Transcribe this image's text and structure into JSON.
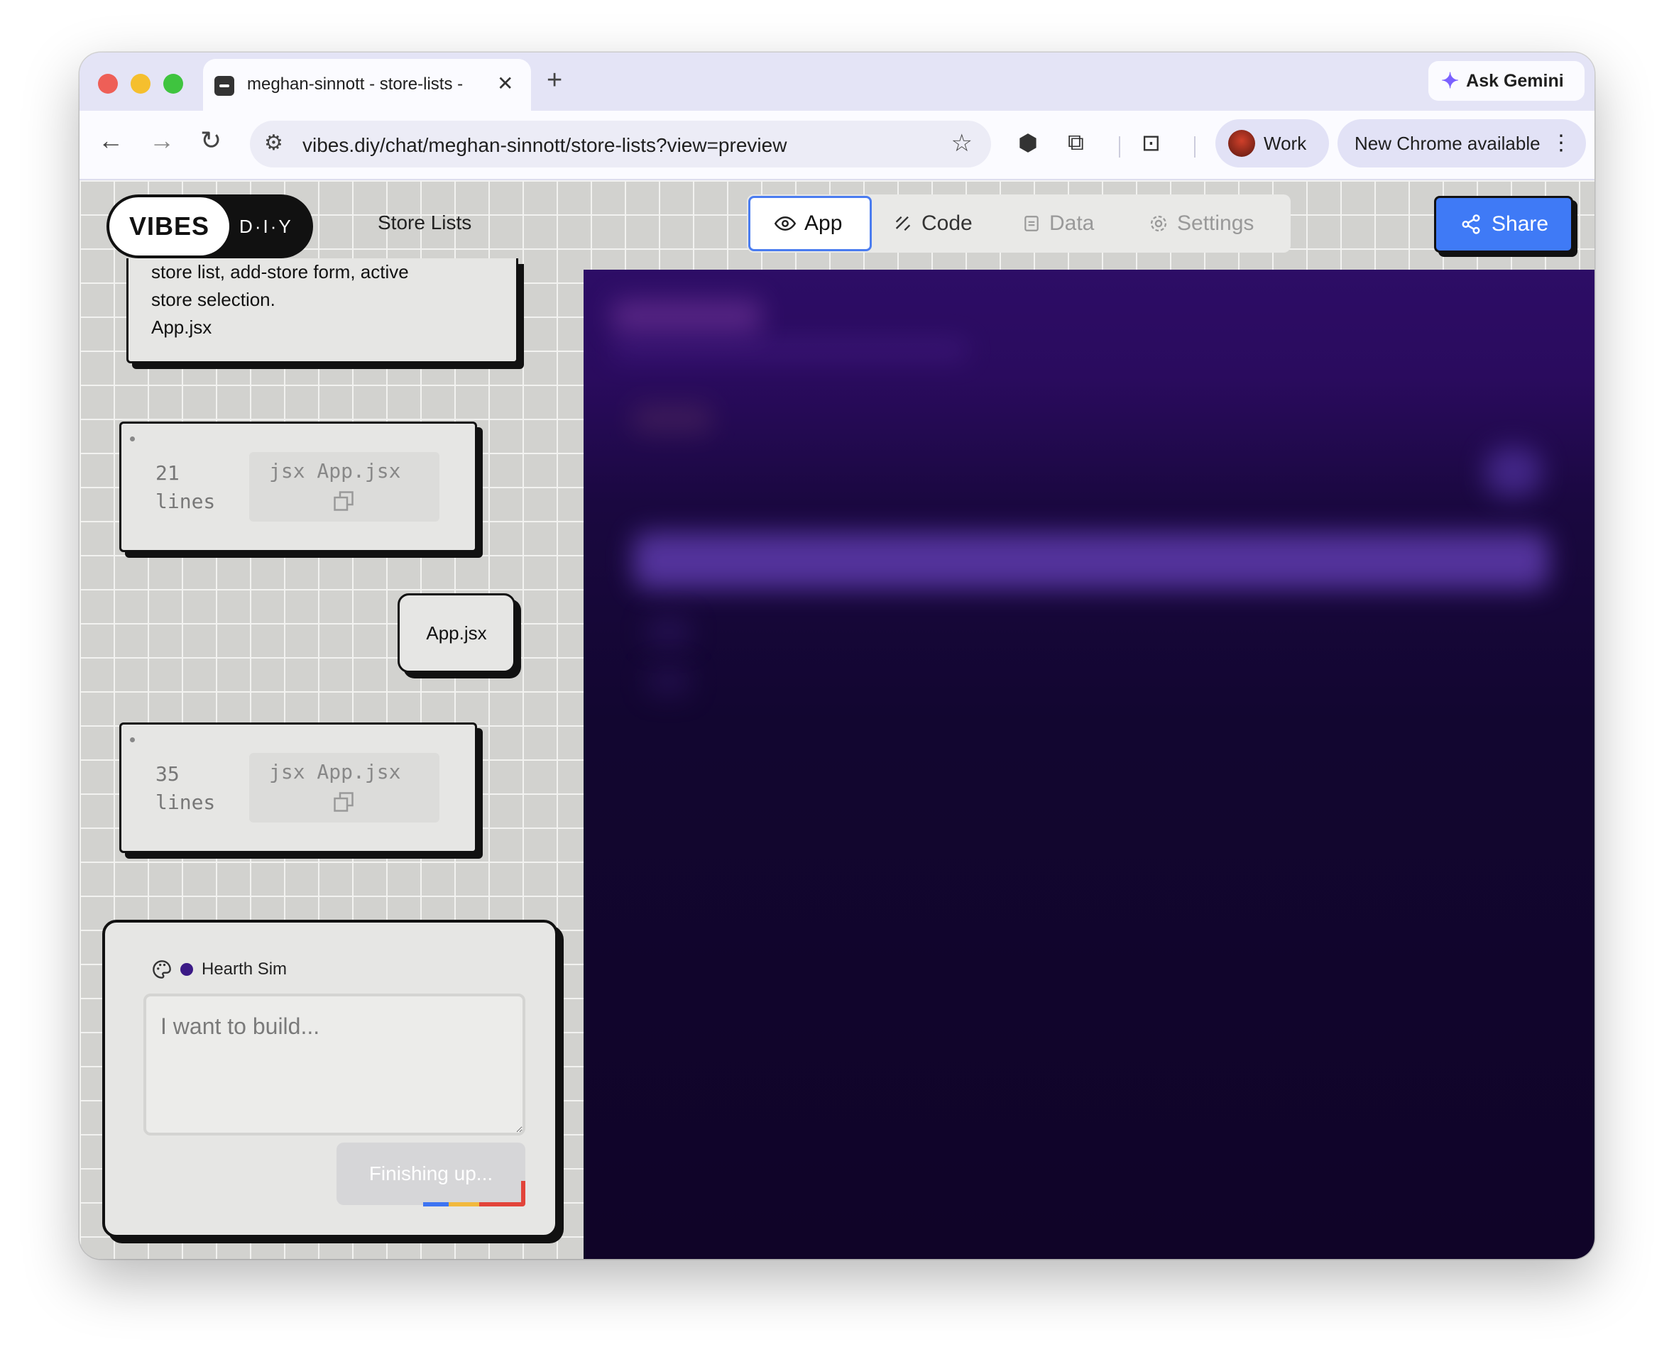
{
  "browser": {
    "tab_title": "meghan-sinnott - store-lists - ",
    "ask_gemini": "Ask Gemini",
    "url": "vibes.diy/chat/meghan-sinnott/store-lists?view=preview",
    "profile": "Work",
    "update": "New Chrome available"
  },
  "app": {
    "logo_left": "VIBES",
    "logo_right": "D·I·Y",
    "title": "Store Lists",
    "tabs": {
      "app": "App",
      "code": "Code",
      "data": "Data",
      "settings": "Settings"
    },
    "share": "Share"
  },
  "messages": {
    "first_line1": "store list, add-store form, active",
    "first_line2": "store selection.",
    "first_file": "App.jsx",
    "code_block_1": {
      "count": "21",
      "unit": "lines",
      "file": "jsx App.jsx"
    },
    "user_bubble": "App.jsx",
    "code_block_2": {
      "count": "35",
      "unit": "lines",
      "file": "jsx App.jsx"
    }
  },
  "composer": {
    "theme": "Hearth Sim",
    "placeholder": "I want to build...",
    "status_button": "Finishing up..."
  },
  "colors": {
    "accent": "#3f7af6",
    "theme_dot": "#3b1a86",
    "preview_top": "#2d0d66",
    "preview_bottom": "#100428"
  }
}
